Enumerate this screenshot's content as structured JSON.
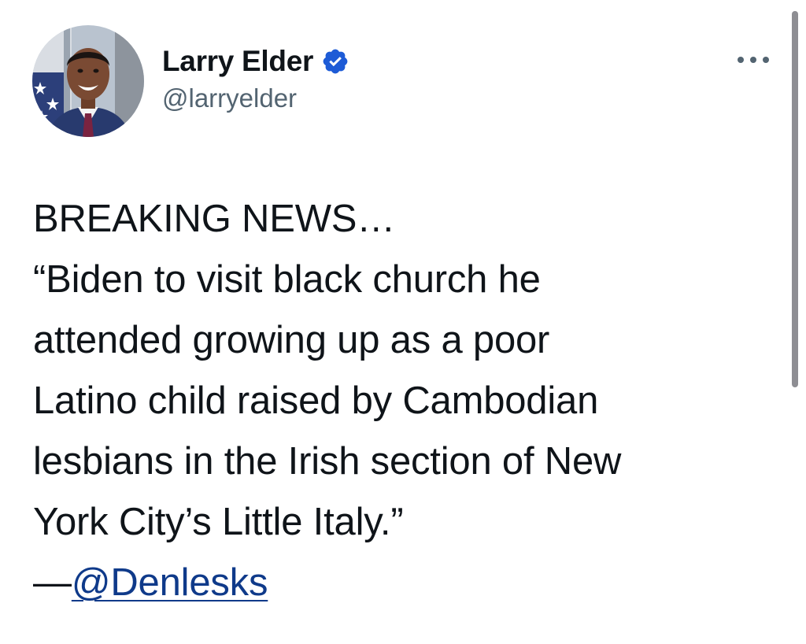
{
  "author": {
    "display_name": "Larry Elder",
    "handle": "@larryelder",
    "verified": true
  },
  "tweet": {
    "headline": "BREAKING NEWS…",
    "quote": "“Biden to visit black church he\nattended growing up as a poor\nLatino child raised by Cambodian\nlesbians in the Irish section of New\nYork City’s Little Italy.”",
    "attribution_dash": "—",
    "attribution_mention": "@Denlesks"
  },
  "colors": {
    "text": "#0f1419",
    "secondary_text": "#536471",
    "verified_badge": "#1d5bd6",
    "mention_link": "#0f3a8a",
    "scrollbar": "#8e8e93"
  },
  "icons": {
    "verified": "verified-badge-icon",
    "more": "more-dots-icon"
  }
}
